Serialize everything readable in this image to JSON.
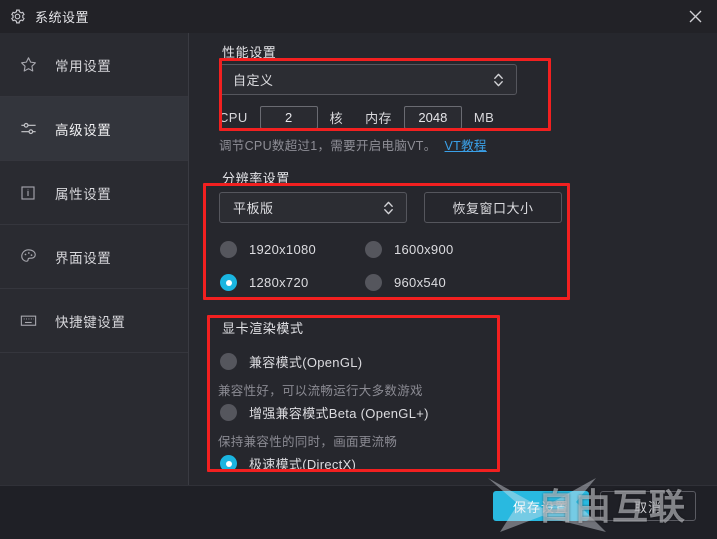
{
  "window": {
    "title": "系统设置",
    "title_icon": "gear-icon",
    "close_icon": "close-icon"
  },
  "sidebar": {
    "items": [
      {
        "label": "常用设置",
        "icon": "star-icon",
        "active": false
      },
      {
        "label": "高级设置",
        "icon": "sliders-icon",
        "active": true
      },
      {
        "label": "属性设置",
        "icon": "info-box-icon",
        "active": false
      },
      {
        "label": "界面设置",
        "icon": "palette-icon",
        "active": false
      },
      {
        "label": "快捷键设置",
        "icon": "keyboard-icon",
        "active": false
      }
    ]
  },
  "performance": {
    "section_title": "性能设置",
    "preset_value": "自定义",
    "cpu_label": "CPU",
    "cpu_value": "2",
    "cpu_unit": "核",
    "memory_label": "内存",
    "memory_value": "2048",
    "memory_unit": "MB",
    "hint_text": "调节CPU数超过1，需要开启电脑VT。",
    "hint_link": "VT教程"
  },
  "resolution": {
    "section_title": "分辨率设置",
    "preset_value": "平板版",
    "restore_button": "恢复窗口大小",
    "options": [
      {
        "label": "1920x1080",
        "selected": false
      },
      {
        "label": "1600x900",
        "selected": false
      },
      {
        "label": "1280x720",
        "selected": true
      },
      {
        "label": "960x540",
        "selected": false
      }
    ]
  },
  "render_mode": {
    "section_title": "显卡渲染模式",
    "options": [
      {
        "label": "兼容模式(OpenGL)",
        "selected": false,
        "desc": "兼容性好，可以流畅运行大多数游戏"
      },
      {
        "label": "增强兼容模式Beta (OpenGL+)",
        "selected": false,
        "desc": "保持兼容性的同时，画面更流畅"
      },
      {
        "label": "极速模式(DirectX)",
        "selected": true,
        "desc": ""
      }
    ]
  },
  "footer": {
    "save_label": "保存设置",
    "cancel_label": "取消"
  },
  "watermark": {
    "text": "自由互联"
  },
  "colors": {
    "accent": "#1ab5e0",
    "annotation": "#f22020",
    "link": "#3aa0e8",
    "window_bg": "#26272d",
    "sidebar_bg": "#2a2b31"
  }
}
